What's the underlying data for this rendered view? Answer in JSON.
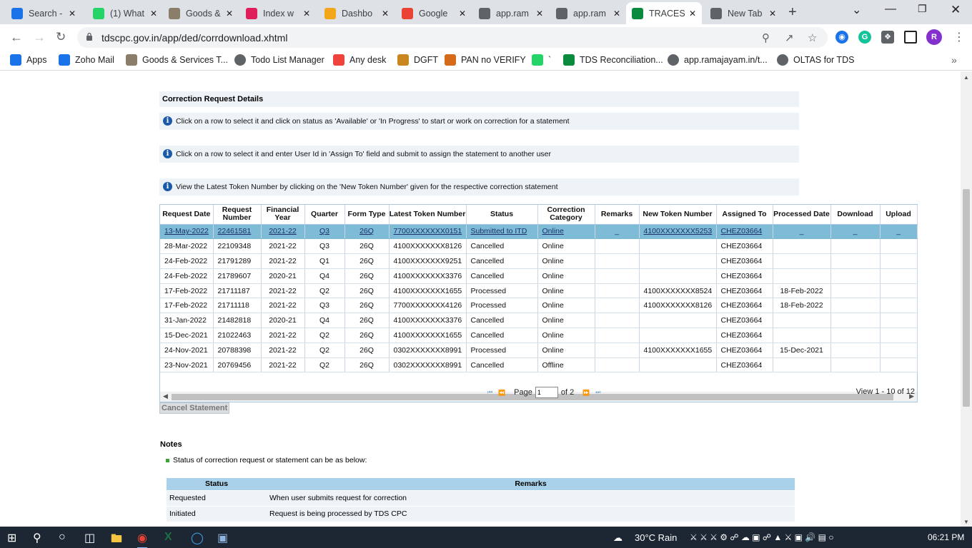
{
  "tabs": [
    {
      "title": "Search -",
      "icon": "home-icon",
      "color": "#1a73e8"
    },
    {
      "title": "(1) What",
      "icon": "whatsapp-icon",
      "color": "#25d366"
    },
    {
      "title": "Goods &",
      "icon": "gst-emblem-icon",
      "color": "#8a7e6a"
    },
    {
      "title": "Index w",
      "icon": "slack-icon",
      "color": "#e01e5a"
    },
    {
      "title": "Dashbo",
      "icon": "dashboard-icon",
      "color": "#f4a61b"
    },
    {
      "title": "Google",
      "icon": "google-icon",
      "color": "#ea4335"
    },
    {
      "title": "app.ram",
      "icon": "globe-icon",
      "color": "#5f6368"
    },
    {
      "title": "app.ram",
      "icon": "globe-icon",
      "color": "#5f6368"
    },
    {
      "title": "TRACES",
      "icon": "traces-icon",
      "color": "#0a8a3c"
    },
    {
      "title": "New Tab",
      "icon": "chrome-icon",
      "color": "#5f6368"
    }
  ],
  "omnibox": {
    "url": "tdscpc.gov.in/app/ded/corrdownload.xhtml"
  },
  "profile_initial": "R",
  "bookmarks": [
    {
      "label": "Apps",
      "icon": "apps-grid-icon",
      "color": "#1a73e8"
    },
    {
      "label": "Zoho Mail",
      "icon": "mail-icon",
      "color": "#1a73e8"
    },
    {
      "label": "Goods & Services T...",
      "icon": "gst-emblem-icon",
      "color": "#8a7e6a"
    },
    {
      "label": "Todo List Manager",
      "icon": "globe-icon",
      "color": "#5f6368"
    },
    {
      "label": "Any desk",
      "icon": "anydesk-icon",
      "color": "#ef443b"
    },
    {
      "label": "DGFT",
      "icon": "dgft-icon",
      "color": "#c9871d"
    },
    {
      "label": "PAN no VERIFY",
      "icon": "pan-icon",
      "color": "#d46a1a"
    },
    {
      "label": "`",
      "icon": "whatsapp-icon",
      "color": "#25d366"
    },
    {
      "label": "TDS Reconciliation...",
      "icon": "traces-icon",
      "color": "#0a8a3c"
    },
    {
      "label": "app.ramajayam.in/t...",
      "icon": "globe-icon",
      "color": "#5f6368"
    },
    {
      "label": "OLTAS for TDS",
      "icon": "globe-icon",
      "color": "#5f6368"
    }
  ],
  "page": {
    "section_title": "Correction Request Details",
    "info": [
      "Click on a row to select it and click on status as 'Available' or 'In Progress' to start or work on correction for a statement",
      "Click on a row to select it and enter User Id in 'Assign To' field and submit to assign the statement to another user",
      "View the Latest Token Number by clicking on the 'New Token Number' given for the respective correction statement"
    ],
    "columns": [
      "Request Date",
      "Request Number",
      "Financial Year",
      "Quarter",
      "Form Type",
      "Latest Token Number",
      "Status",
      "Correction Category",
      "Remarks",
      "New Token Number",
      "Assigned To",
      "Processed Date",
      "Download",
      "Upload"
    ],
    "rows": [
      [
        "13-May-2022",
        "22461581",
        "2021-22",
        "Q3",
        "26Q",
        "7700XXXXXXX0151",
        "Submitted to ITD",
        "Online",
        "_",
        "4100XXXXXXX5253",
        "CHEZ03664",
        "_",
        "_",
        "_"
      ],
      [
        "28-Mar-2022",
        "22109348",
        "2021-22",
        "Q3",
        "26Q",
        "4100XXXXXXX8126",
        "Cancelled",
        "Online",
        "",
        "",
        "CHEZ03664",
        "",
        "",
        ""
      ],
      [
        "24-Feb-2022",
        "21791289",
        "2021-22",
        "Q1",
        "26Q",
        "4100XXXXXXX9251",
        "Cancelled",
        "Online",
        "",
        "",
        "CHEZ03664",
        "",
        "",
        ""
      ],
      [
        "24-Feb-2022",
        "21789607",
        "2020-21",
        "Q4",
        "26Q",
        "4100XXXXXXX3376",
        "Cancelled",
        "Online",
        "",
        "",
        "CHEZ03664",
        "",
        "",
        ""
      ],
      [
        "17-Feb-2022",
        "21711187",
        "2021-22",
        "Q2",
        "26Q",
        "4100XXXXXXX1655",
        "Processed",
        "Online",
        "",
        "4100XXXXXXX8524",
        "CHEZ03664",
        "18-Feb-2022",
        "",
        ""
      ],
      [
        "17-Feb-2022",
        "21711118",
        "2021-22",
        "Q3",
        "26Q",
        "7700XXXXXXX4126",
        "Processed",
        "Online",
        "",
        "4100XXXXXXX8126",
        "CHEZ03664",
        "18-Feb-2022",
        "",
        ""
      ],
      [
        "31-Jan-2022",
        "21482818",
        "2020-21",
        "Q4",
        "26Q",
        "4100XXXXXXX3376",
        "Cancelled",
        "Online",
        "",
        "",
        "CHEZ03664",
        "",
        "",
        ""
      ],
      [
        "15-Dec-2021",
        "21022463",
        "2021-22",
        "Q2",
        "26Q",
        "4100XXXXXXX1655",
        "Cancelled",
        "Online",
        "",
        "",
        "CHEZ03664",
        "",
        "",
        ""
      ],
      [
        "24-Nov-2021",
        "20788398",
        "2021-22",
        "Q2",
        "26Q",
        "0302XXXXXXX8991",
        "Processed",
        "Online",
        "",
        "4100XXXXXXX1655",
        "CHEZ03664",
        "15-Dec-2021",
        "",
        ""
      ],
      [
        "23-Nov-2021",
        "20769456",
        "2021-22",
        "Q2",
        "26Q",
        "0302XXXXXXX8991",
        "Cancelled",
        "Offline",
        "",
        "",
        "CHEZ03664",
        "",
        "",
        ""
      ]
    ],
    "pager": {
      "page_label": "Page",
      "page_value": "1",
      "of_label": "of 2",
      "view_text": "View 1 - 10 of 12"
    },
    "cancel_button": "Cancel Statement",
    "notes_title": "Notes",
    "notes_bullet": "Status of correction request or statement can be as below:",
    "notes_columns": [
      "Status",
      "Remarks"
    ],
    "notes_rows": [
      [
        "Requested",
        "When user submits request for correction"
      ],
      [
        "Initiated",
        "Request is being processed by TDS CPC"
      ]
    ]
  },
  "taskbar": {
    "weather": "30°C  Rain",
    "time": "06:21 PM"
  }
}
